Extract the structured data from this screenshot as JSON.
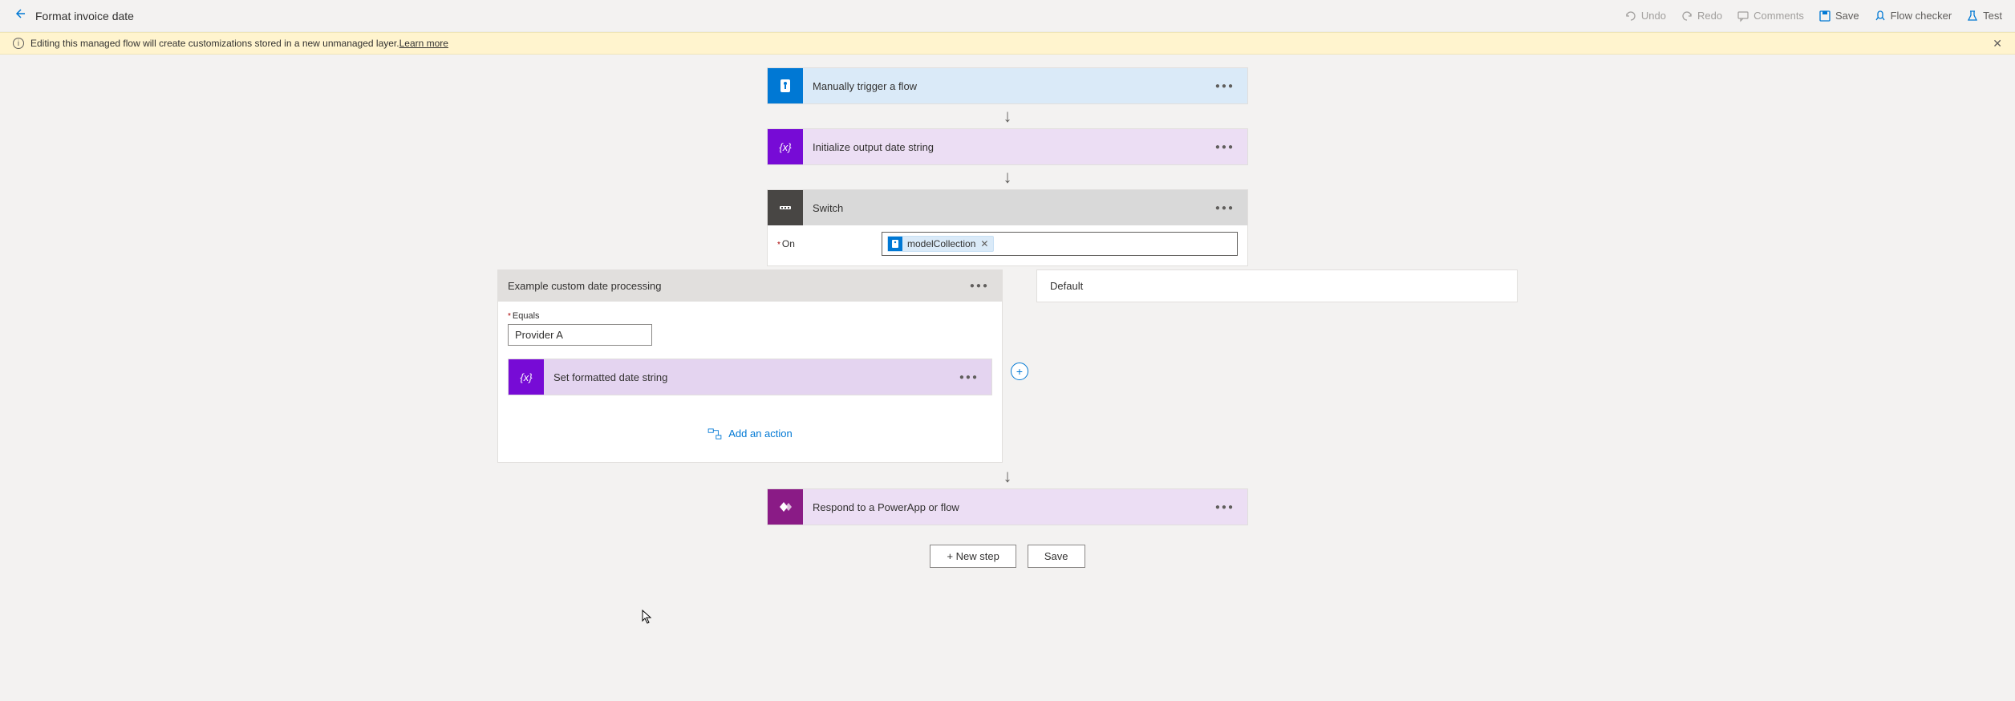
{
  "header": {
    "title": "Format invoice date",
    "actions": {
      "undo": "Undo",
      "redo": "Redo",
      "comments": "Comments",
      "save": "Save",
      "flowChecker": "Flow checker",
      "test": "Test"
    }
  },
  "banner": {
    "text": "Editing this managed flow will create customizations stored in a new unmanaged layer. ",
    "linkText": "Learn more"
  },
  "steps": {
    "trigger": {
      "title": "Manually trigger a flow"
    },
    "initVar": {
      "title": "Initialize output date string"
    },
    "switch": {
      "title": "Switch",
      "onLabel": "On",
      "tokenName": "modelCollection"
    },
    "case": {
      "title": "Example custom date processing",
      "equalsLabel": "Equals",
      "equalsValue": "Provider A",
      "innerActionTitle": "Set formatted date string",
      "addAction": "Add an action"
    },
    "default": {
      "title": "Default"
    },
    "respond": {
      "title": "Respond to a PowerApp or flow"
    }
  },
  "buttons": {
    "newStep": "+ New step",
    "save": "Save"
  }
}
